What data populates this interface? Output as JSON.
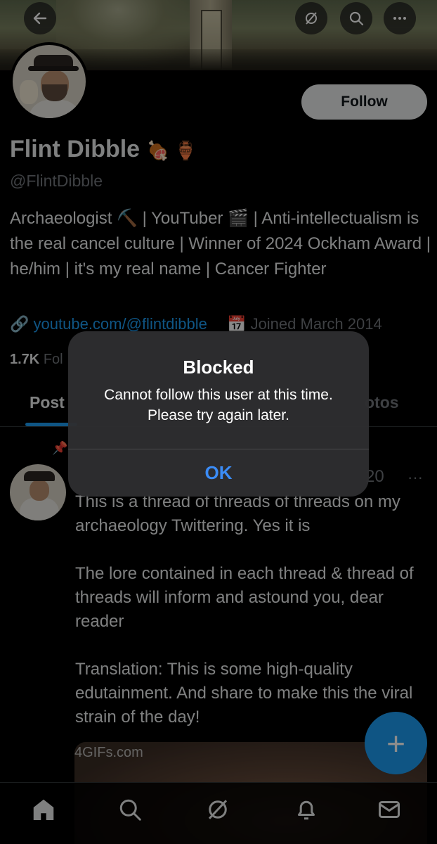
{
  "profile": {
    "name": "Flint Dibble",
    "name_emojis": "🍖 🏺",
    "handle": "@FlintDibble",
    "bio": "Archaeologist ⛏️ | YouTuber 🎬 | Anti-intellectualism is the real cancel culture | Winner of 2024 Ockham Award | he/him | it's my real name | Cancer Fighter",
    "link": "youtube.com/@flintdibble",
    "joined": "Joined March 2014",
    "followers_count": "1.7K",
    "followers_label": "Fol",
    "follow_label": "Follow"
  },
  "tabs": {
    "posts_label": "Post",
    "photos_label": "otos"
  },
  "post": {
    "date": "20",
    "more": "···",
    "text": "This is a thread of threads of threads on my archaeology Twittering. Yes it is\n\nThe lore contained in each thread & thread of threads will inform and astound you, dear reader\n\nTranslation: This is some high-quality edutainment. And share to make this the viral strain of the day!",
    "media_watermark": "4GIFs.com"
  },
  "fab": {
    "label": "+"
  },
  "alert": {
    "title": "Blocked",
    "message": "Cannot follow this user at this time. Please try again later.",
    "ok_label": "OK"
  },
  "colors": {
    "accent": "#1d9bf0",
    "alert_button": "#3b8cf6",
    "text_primary": "#e7e9ea",
    "text_secondary": "#71767b"
  },
  "icons": {
    "header": [
      "back-arrow-icon",
      "grok-icon",
      "search-icon",
      "more-icon"
    ],
    "nav": [
      "home-icon",
      "search-icon",
      "grok-icon",
      "notifications-icon",
      "messages-icon"
    ]
  }
}
